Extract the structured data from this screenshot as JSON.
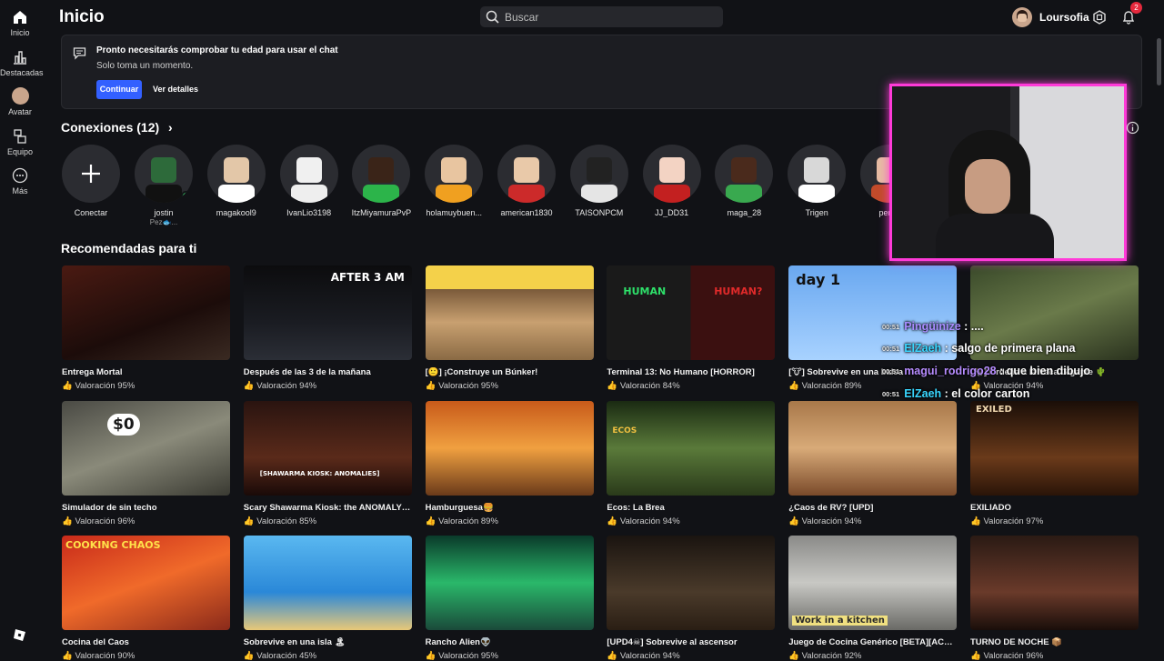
{
  "sidebar": {
    "items": [
      {
        "label": "Inicio",
        "icon": "home-icon"
      },
      {
        "label": "Destacadas",
        "icon": "chart-icon"
      },
      {
        "label": "Avatar",
        "icon": "avatar-icon"
      },
      {
        "label": "Equipo",
        "icon": "inventory-icon"
      },
      {
        "label": "Más",
        "icon": "more-icon"
      }
    ]
  },
  "header": {
    "title": "Inicio",
    "search_placeholder": "Buscar",
    "username": "Loursofia",
    "notification_count": "2"
  },
  "notice": {
    "title": "Pronto necesitarás comprobar tu edad para usar el chat",
    "subtitle": "Solo toma un momento.",
    "continue_label": "Continuar",
    "details_label": "Ver detalles"
  },
  "connections": {
    "title": "Conexiones (12)",
    "add_label": "Conectar",
    "friends": [
      {
        "name": "jostin",
        "status": "Pez🐟...",
        "online": true
      },
      {
        "name": "magakool9"
      },
      {
        "name": "IvanLio3198"
      },
      {
        "name": "ItzMiyamuraPvP"
      },
      {
        "name": "holamuybuen..."
      },
      {
        "name": "american1830"
      },
      {
        "name": "TAISONPCM"
      },
      {
        "name": "JJ_DD31"
      },
      {
        "name": "maga_28"
      },
      {
        "name": "Trigen"
      },
      {
        "name": "perua"
      }
    ]
  },
  "recommended": {
    "title": "Recomendadas para ti",
    "games": [
      {
        "name": "Entrega Mortal",
        "rating": "Valoración 95%"
      },
      {
        "name": "Después de las 3 de la mañana",
        "rating": "Valoración 94%",
        "thumb_text": "AFTER 3 AM"
      },
      {
        "name": "[🙂] ¡Construye un Búnker!",
        "rating": "Valoración 95%"
      },
      {
        "name": "Terminal 13: No Humano [HORROR]",
        "rating": "Valoración 84%",
        "thumb_text": "HUMAN",
        "thumb_text2": "HUMAN?"
      },
      {
        "name": "[🐮] Sobrevive en una balsa",
        "rating": "Valoración 89%",
        "thumb_text": "day 1"
      },
      {
        "name": "[🐄] Ordeña a la Vaca Gigante 🌵",
        "rating": "Valoración 94%"
      },
      {
        "name": "Simulador de sin techo",
        "rating": "Valoración 96%",
        "thumb_text": "$0"
      },
      {
        "name": "Scary Shawarma Kiosk: the ANOMALY [...",
        "rating": "Valoración 85%",
        "thumb_text": "[SHAWARMA KIOSK: ANOMALIES]"
      },
      {
        "name": "Hamburguesa🍔",
        "rating": "Valoración 89%"
      },
      {
        "name": "Ecos: La Brea",
        "rating": "Valoración 94%",
        "thumb_text": "ECOS"
      },
      {
        "name": "¿Caos de RV? [UPD]",
        "rating": "Valoración 94%"
      },
      {
        "name": "EXILIADO",
        "rating": "Valoración 97%",
        "thumb_text": "EXILED"
      },
      {
        "name": "Cocina del Caos",
        "rating": "Valoración 90%",
        "thumb_text": "COOKING CHAOS"
      },
      {
        "name": "Sobrevive en una isla 🏝",
        "rating": "Valoración 45%"
      },
      {
        "name": "Rancho Alien👽",
        "rating": "Valoración 95%"
      },
      {
        "name": "[UPD4☠] Sobrevive al ascensor",
        "rating": "Valoración 94%"
      },
      {
        "name": "Juego de Cocina Genérico [BETA][ACT2...",
        "rating": "Valoración 92%",
        "thumb_text": "Work in a kitchen"
      },
      {
        "name": "TURNO DE NOCHE 📦",
        "rating": "Valoración 96%"
      }
    ]
  },
  "stream_chat": [
    {
      "time": "00:51",
      "user": "Pingüinize",
      "msg": ": ....",
      "color": "#a88cff"
    },
    {
      "time": "00:51",
      "user": "ElZaeh",
      "msg": ": salgo de primera plana",
      "color": "#39d6ff"
    },
    {
      "time": "00:51",
      "user": "magui_rodrigo28",
      "msg": ": que bien dibujo",
      "color": "#b68cff"
    },
    {
      "time": "00:51",
      "user": "ElZaeh",
      "msg": ": el color carton",
      "color": "#39d6ff"
    }
  ],
  "colors": {
    "background": "#111216",
    "accent": "#3360ff",
    "online": "#3ccf6b",
    "webcam_pink": "#ff3ad8",
    "webcam_cyan": "#2ee6ff"
  }
}
